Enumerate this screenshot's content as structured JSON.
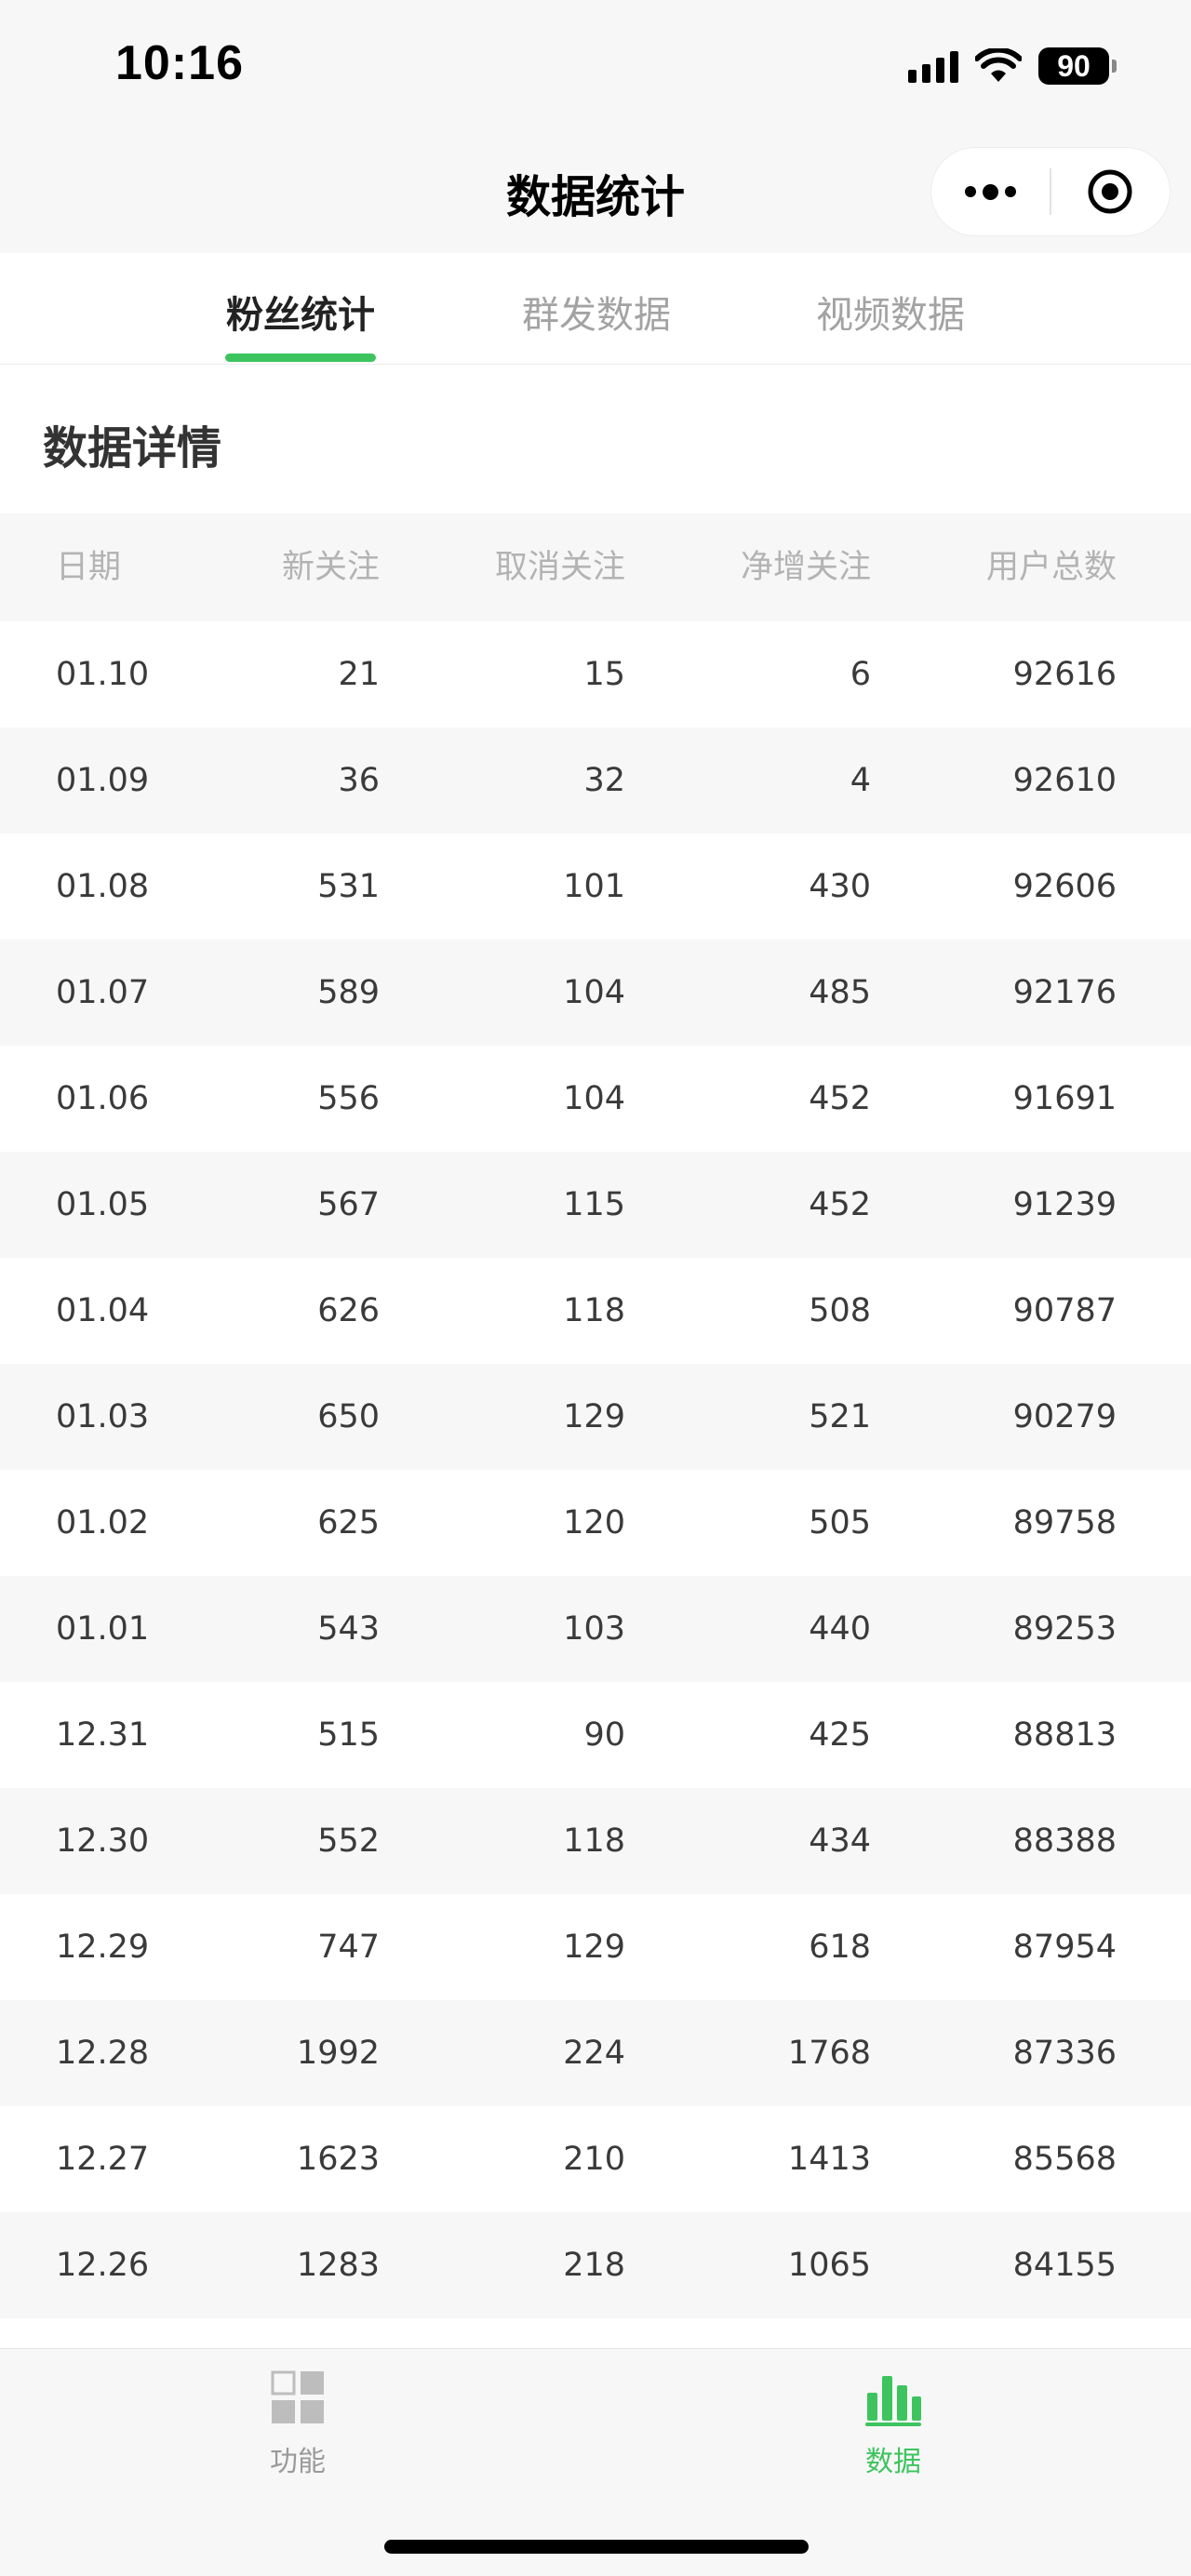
{
  "status_bar": {
    "time": "10:16",
    "battery": "90",
    "icons": [
      "signal-icon",
      "wifi-icon",
      "battery-icon"
    ]
  },
  "nav": {
    "title": "数据统计",
    "more_icon": "more-dots-icon",
    "close_icon": "target-circle-icon"
  },
  "tabs": [
    {
      "label": "粉丝统计",
      "active": true
    },
    {
      "label": "群发数据",
      "active": false
    },
    {
      "label": "视频数据",
      "active": false
    }
  ],
  "section_title": "数据详情",
  "table": {
    "headers": [
      "日期",
      "新关注",
      "取消关注",
      "净增关注",
      "用户总数"
    ],
    "rows": [
      [
        "01.10",
        "21",
        "15",
        "6",
        "92616"
      ],
      [
        "01.09",
        "36",
        "32",
        "4",
        "92610"
      ],
      [
        "01.08",
        "531",
        "101",
        "430",
        "92606"
      ],
      [
        "01.07",
        "589",
        "104",
        "485",
        "92176"
      ],
      [
        "01.06",
        "556",
        "104",
        "452",
        "91691"
      ],
      [
        "01.05",
        "567",
        "115",
        "452",
        "91239"
      ],
      [
        "01.04",
        "626",
        "118",
        "508",
        "90787"
      ],
      [
        "01.03",
        "650",
        "129",
        "521",
        "90279"
      ],
      [
        "01.02",
        "625",
        "120",
        "505",
        "89758"
      ],
      [
        "01.01",
        "543",
        "103",
        "440",
        "89253"
      ],
      [
        "12.31",
        "515",
        "90",
        "425",
        "88813"
      ],
      [
        "12.30",
        "552",
        "118",
        "434",
        "88388"
      ],
      [
        "12.29",
        "747",
        "129",
        "618",
        "87954"
      ],
      [
        "12.28",
        "1992",
        "224",
        "1768",
        "87336"
      ],
      [
        "12.27",
        "1623",
        "210",
        "1413",
        "85568"
      ],
      [
        "12.26",
        "1283",
        "218",
        "1065",
        "84155"
      ]
    ]
  },
  "bottom_tabs": [
    {
      "label": "功能",
      "icon": "grid-icon",
      "active": false
    },
    {
      "label": "数据",
      "icon": "bar-chart-icon",
      "active": true
    }
  ],
  "colors": {
    "accent": "#3dc45f",
    "inactive": "#9a9a9a",
    "background_gray": "#f7f7f7"
  }
}
